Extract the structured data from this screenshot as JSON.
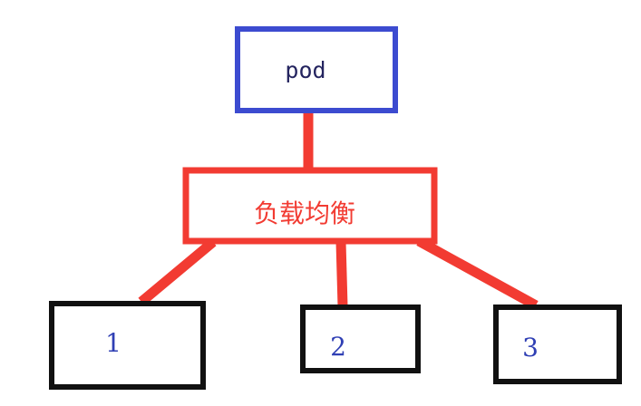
{
  "diagram": {
    "pod_label": "pod",
    "balancer_label": "负载均衡",
    "nodes": [
      {
        "label": "1"
      },
      {
        "label": "2"
      },
      {
        "label": "3"
      }
    ]
  },
  "colors": {
    "pod_border": "#3c4bd0",
    "pod_text": "#24245f",
    "balancer": "#f23b32",
    "node_border": "#111111",
    "node_text": "#2f3fb4"
  }
}
